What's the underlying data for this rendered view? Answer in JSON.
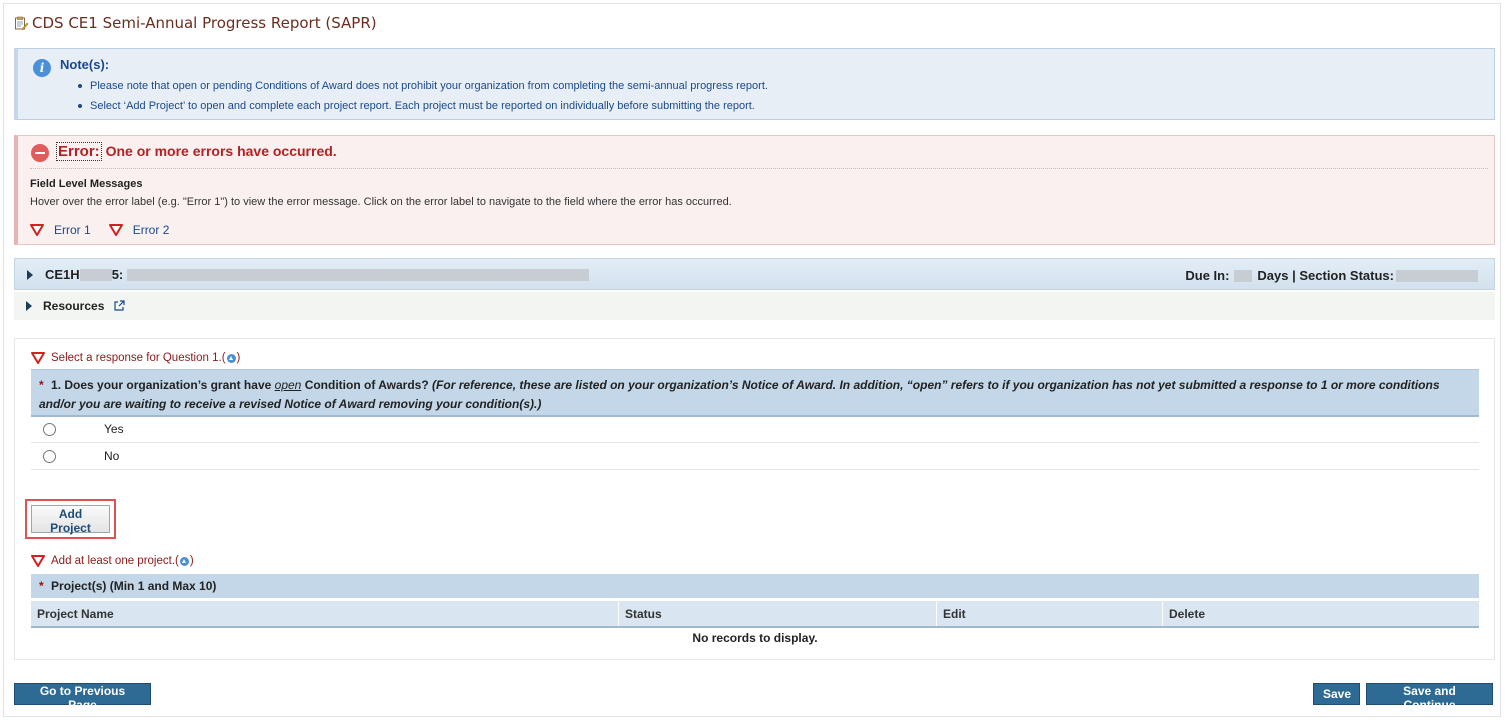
{
  "page": {
    "title": "CDS CE1 Semi-Annual Progress Report (SAPR)"
  },
  "note": {
    "title": "Note(s):",
    "items": [
      "Please note that open or pending Conditions of Award does not prohibit your organization from completing the semi-annual progress report.",
      "Select ‘Add Project’ to open and complete each project report. Each project must be reported on individually before submitting the report."
    ]
  },
  "error": {
    "label": "Error:",
    "message": "One or more errors have occurred.",
    "field_title": "Field Level Messages",
    "field_text": "Hover over the error label (e.g. \"Error 1\") to view the error message. Click on the error label to navigate to the field where the error has occurred.",
    "links": [
      "Error 1",
      "Error 2"
    ]
  },
  "section": {
    "id_prefix": "CE1H",
    "id_suffix": "5:",
    "due_in_label": "Due In:",
    "days_label": "Days | Section Status:"
  },
  "resources": {
    "label": "Resources"
  },
  "question1": {
    "validation": "Select a response for Question 1.",
    "text_start": "1. Does your organization’s grant have",
    "text_open": "open",
    "text_mid": "Condition of Awards?",
    "text_italic": "(For reference, these are listed on your organization’s Notice of Award. In addition, “open” refers to if you organization has not yet submitted a response to 1 or more conditions and/or you are waiting to receive a revised Notice of Award removing your condition(s).)",
    "options": [
      "Yes",
      "No"
    ]
  },
  "projects": {
    "add_button": "Add Project",
    "validation": "Add at least one project.",
    "header": "Project(s) (Min 1 and Max 10)",
    "columns": [
      "Project Name",
      "Status",
      "Edit",
      "Delete"
    ],
    "empty": "No records to display."
  },
  "footer": {
    "prev_button": "Go to Previous Page",
    "save_button": "Save",
    "save_continue_button": "Save and Continue"
  },
  "colors": {
    "title": "#6b2d1f",
    "link": "#1a4a8a",
    "error": "#b22222",
    "button": "#2d6b95",
    "highlight": "#e05252"
  },
  "icons": [
    "report-icon",
    "info-icon",
    "error-icon",
    "error-triangle-icon",
    "caret-right-icon",
    "external-link-icon",
    "scroll-up-icon"
  ]
}
